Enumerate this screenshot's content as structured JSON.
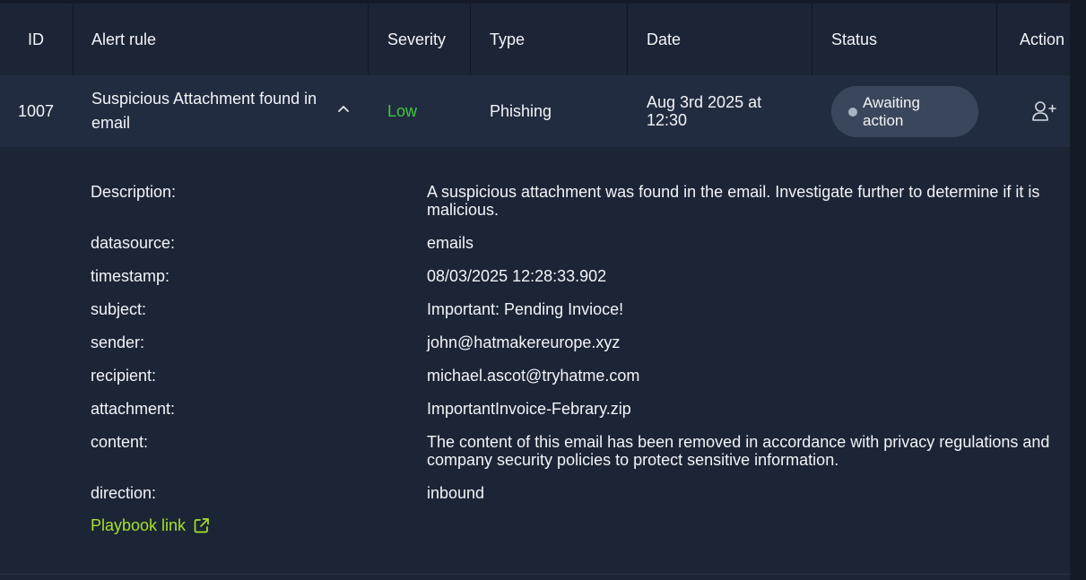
{
  "columns": {
    "id": "ID",
    "alert_rule": "Alert rule",
    "severity": "Severity",
    "type": "Type",
    "date": "Date",
    "status": "Status",
    "action": "Action"
  },
  "alert": {
    "id": "1007",
    "rule": "Suspicious Attachment found in email",
    "severity": "Low",
    "severity_color": "#3ec93a",
    "type": "Phishing",
    "date": "Aug 3rd 2025 at 12:30",
    "status": "Awaiting action",
    "expand_icon": "chevron-up-icon",
    "action_icon": "add-user-icon"
  },
  "details": [
    {
      "key": "Description:",
      "value": "A suspicious attachment was found in the email. Investigate further to determine if it is malicious."
    },
    {
      "key": "datasource:",
      "value": "emails"
    },
    {
      "key": "timestamp:",
      "value": "08/03/2025 12:28:33.902"
    },
    {
      "key": "subject:",
      "value": "Important: Pending Invioce!"
    },
    {
      "key": "sender:",
      "value": "john@hatmakereurope.xyz"
    },
    {
      "key": "recipient:",
      "value": "michael.ascot@tryhatme.com"
    },
    {
      "key": "attachment:",
      "value": "ImportantInvoice-Febrary.zip"
    },
    {
      "key": "content:",
      "value": "The content of this email has been removed in accordance with privacy regulations and company security policies to protect sensitive information."
    },
    {
      "key": "direction:",
      "value": "inbound"
    }
  ],
  "playbook": {
    "label": "Playbook link",
    "icon": "external-link-icon",
    "color": "#a6e02c"
  },
  "colors": {
    "background": "#1c2535",
    "row_highlight": "#222c40",
    "status_pill": "#3a465b"
  }
}
